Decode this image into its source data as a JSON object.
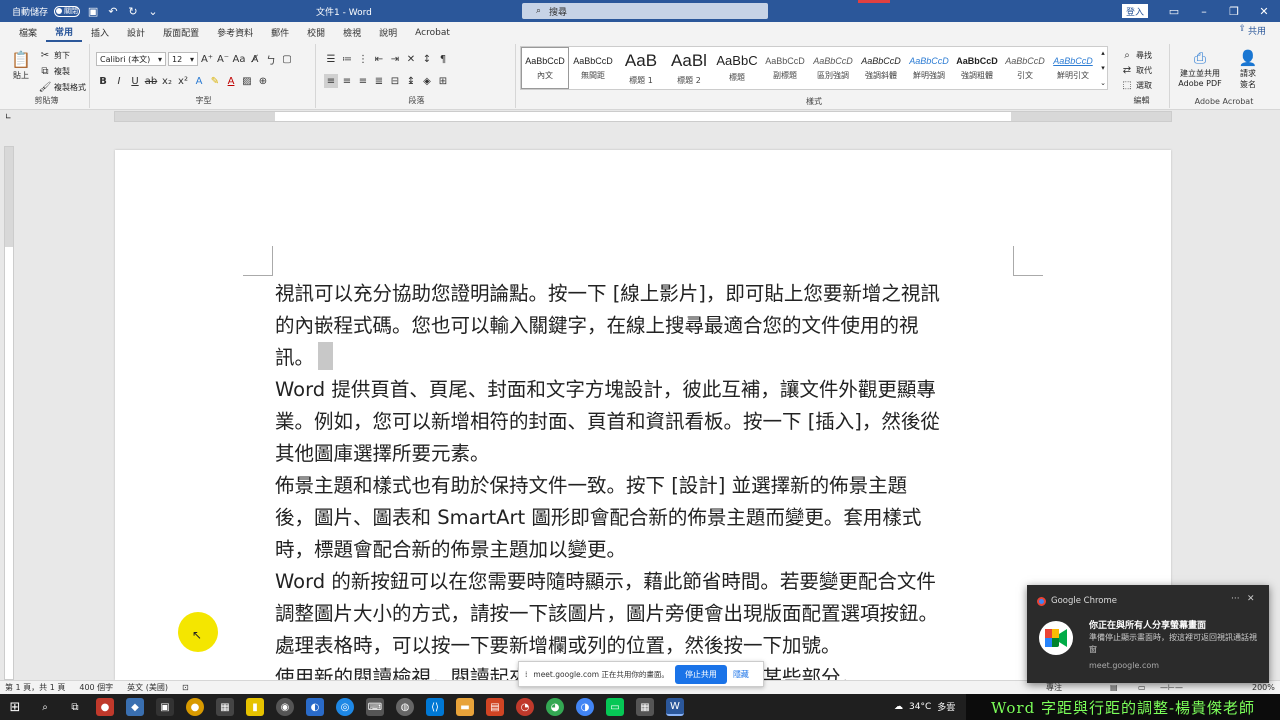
{
  "titlebar": {
    "autosave_label": "自動儲存",
    "autosave_state": "關閉",
    "doc_title": "文件1 - Word",
    "search_placeholder": "搜尋",
    "login": "登入"
  },
  "tabs": [
    "檔案",
    "常用",
    "插入",
    "設計",
    "版面配置",
    "參考資料",
    "郵件",
    "校閱",
    "檢視",
    "說明",
    "Acrobat"
  ],
  "active_tab": "常用",
  "share_label": "共用",
  "ribbon": {
    "clipboard": {
      "paste": "貼上",
      "cut": "剪下",
      "copy": "複製",
      "format_painter": "複製格式",
      "label": "剪貼簿"
    },
    "font": {
      "name": "Calibri (本文)",
      "size": "12",
      "label": "字型"
    },
    "paragraph": {
      "label": "段落"
    },
    "styles": {
      "label": "樣式",
      "items": [
        {
          "sample": "AaBbCcD",
          "name": "內文"
        },
        {
          "sample": "AaBbCcD",
          "name": "無間距"
        },
        {
          "sample": "AaB",
          "name": "標題 1"
        },
        {
          "sample": "AaBl",
          "name": "標題 2"
        },
        {
          "sample": "AaBbC",
          "name": "標題"
        },
        {
          "sample": "AaBbCcD",
          "name": "副標題"
        },
        {
          "sample": "AaBbCcD",
          "name": "區別強調"
        },
        {
          "sample": "AaBbCcD",
          "name": "強調斜體"
        },
        {
          "sample": "AaBbCcD",
          "name": "鮮明強調"
        },
        {
          "sample": "AaBbCcD",
          "name": "強調粗體"
        },
        {
          "sample": "AaBbCcD",
          "name": "引文"
        },
        {
          "sample": "AaBbCcD",
          "name": "鮮明引文"
        }
      ]
    },
    "editing": {
      "find": "尋找",
      "replace": "取代",
      "select": "選取",
      "label": "編輯"
    },
    "acrobat": {
      "create_pdf_1": "建立並共用",
      "create_pdf_2": "Adobe PDF",
      "request_1": "請求",
      "request_2": "簽名",
      "label": "Adobe Acrobat"
    }
  },
  "document": {
    "lines": [
      "視訊可以充分協助您證明論點。按一下 [線上影片]，即可貼上您要新增之視訊",
      "的內嵌程式碼。您也可以輸入關鍵字，在線上搜尋最適合您的文件使用的視",
      "訊。",
      "Word 提供頁首、頁尾、封面和文字方塊設計，彼此互補，讓文件外觀更顯專",
      "業。例如，您可以新增相符的封面、頁首和資訊看板。按一下 [插入]，然後從",
      "其他圖庫選擇所要元素。",
      "佈景主題和樣式也有助於保持文件一致。按下 [設計] 並選擇新的佈景主題",
      "後，圖片、圖表和 SmartArt 圖形即會配合新的佈景主題而變更。套用樣式",
      "時，標題會配合新的佈景主題加以變更。",
      "Word 的新按鈕可以在您需要時隨時顯示，藉此節省時間。若要變更配合文件",
      "調整圖片大小的方式，請按一下該圖片，圖片旁便會出現版面配置選項按鈕。",
      "處理表格時，可以按一下要新增欄或列的位置，然後按一下加號。",
      "使用新的閱讀檢視，閱讀起來更輕鬆。您可以摺疊文件的某些部分，"
    ]
  },
  "statusbar": {
    "page": "第 1 頁，共 1 頁",
    "words": "400 個字",
    "lang": "英文 (美國)",
    "focus": "專注",
    "zoom": "200%"
  },
  "sharebar": {
    "text": "meet.google.com 正在共用你的畫面。",
    "stop": "停止共用",
    "hide": "隱藏"
  },
  "notification": {
    "app": "Google Chrome",
    "title": "你正在與所有人分享螢幕畫面",
    "body": "準備停止顯示畫面時，按這裡可返回視訊通話視窗",
    "url": "meet.google.com"
  },
  "taskbar": {
    "weather": "34°C",
    "weather_text": "多雲"
  },
  "banner": "Word 字距與行距的調整-楊貴傑老師"
}
